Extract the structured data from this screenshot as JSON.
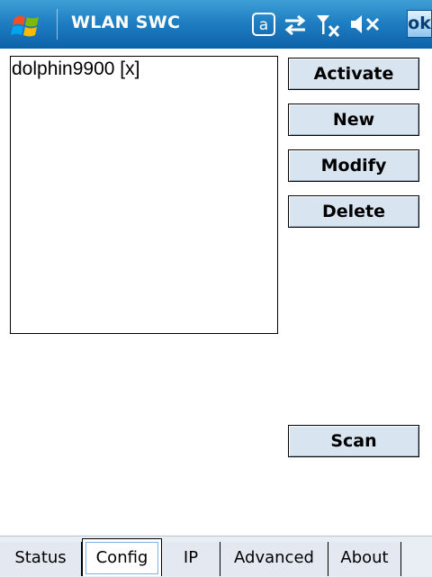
{
  "titlebar": {
    "title": "WLAN SWC",
    "ok_label": "ok",
    "icons": [
      "windows-start-icon",
      "at-sign-icon",
      "connectivity-arrows-icon",
      "signal-off-icon",
      "speaker-muted-icon"
    ]
  },
  "networks": {
    "items": [
      {
        "label": "dolphin9900 [x]"
      }
    ]
  },
  "buttons": {
    "activate": "Activate",
    "new": "New",
    "modify": "Modify",
    "delete": "Delete",
    "scan": "Scan"
  },
  "tabs": [
    {
      "label": "Status"
    },
    {
      "label": "Config",
      "active": true
    },
    {
      "label": "IP"
    },
    {
      "label": "Advanced"
    },
    {
      "label": "About"
    }
  ],
  "colors": {
    "titlebar": "#1f7fc2",
    "button_face": "#d8e4f0",
    "tab_face": "#e4e9f1"
  }
}
